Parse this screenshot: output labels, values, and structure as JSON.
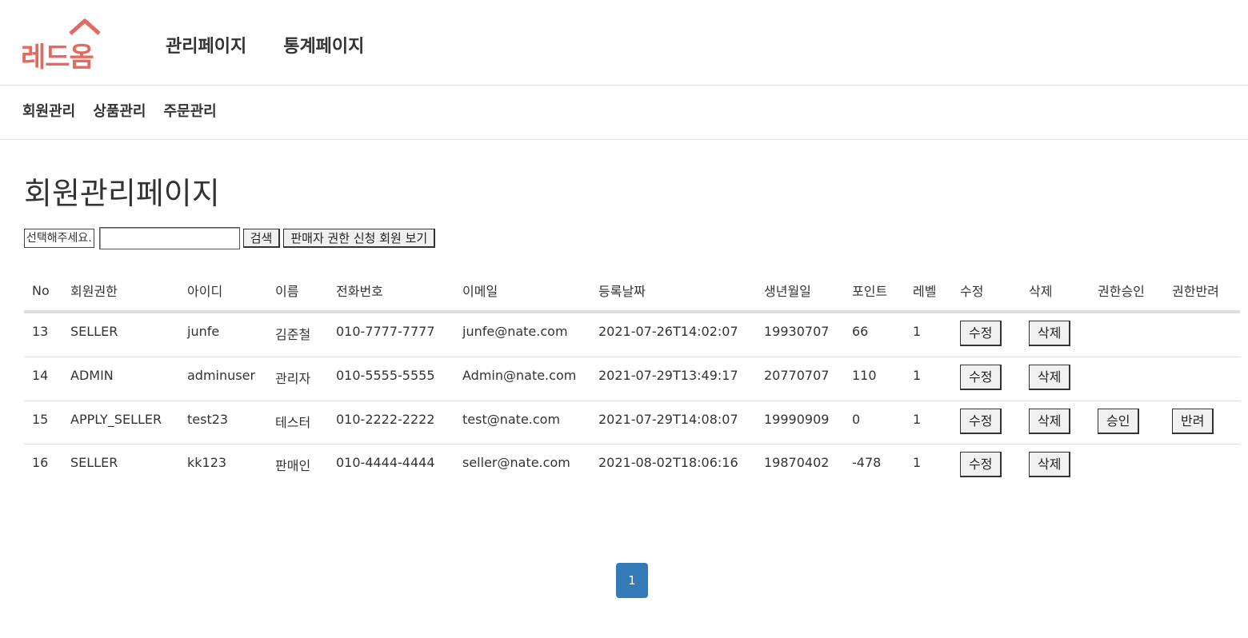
{
  "logo": {
    "text": "레드옴",
    "color": "#e26a5f"
  },
  "topnav": [
    {
      "label": "관리페이지"
    },
    {
      "label": "통계페이지"
    }
  ],
  "subnav": [
    {
      "label": "회원관리"
    },
    {
      "label": "상품관리"
    },
    {
      "label": "주문관리"
    }
  ],
  "page_title": "회원관리페이지",
  "search": {
    "select_label": "선택해주세요.",
    "input_value": "",
    "search_button": "검색",
    "apply_button": "판매자 권한 신청 회원 보기"
  },
  "table": {
    "headers": [
      "No",
      "회원권한",
      "아이디",
      "이름",
      "전화번호",
      "이메일",
      "등록날짜",
      "생년월일",
      "포인트",
      "레벨",
      "수정",
      "삭제",
      "권한승인",
      "권한반려"
    ],
    "rows": [
      {
        "no": "13",
        "role": "SELLER",
        "id": "junfe",
        "name": "김준철",
        "phone": "010-7777-7777",
        "email": "junfe@nate.com",
        "date": "2021-07-26T14:02:07",
        "birth": "19930707",
        "point": "66",
        "level": "1",
        "edit": "수정",
        "delete": "삭제"
      },
      {
        "no": "14",
        "role": "ADMIN",
        "id": "adminuser",
        "name": "관리자",
        "phone": "010-5555-5555",
        "email": "Admin@nate.com",
        "date": "2021-07-29T13:49:17",
        "birth": "20770707",
        "point": "110",
        "level": "1",
        "edit": "수정",
        "delete": "삭제"
      },
      {
        "no": "15",
        "role": "APPLY_SELLER",
        "id": "test23",
        "name": "테스터",
        "phone": "010-2222-2222",
        "email": "test@nate.com",
        "date": "2021-07-29T14:08:07",
        "birth": "19990909",
        "point": "0",
        "level": "1",
        "edit": "수정",
        "delete": "삭제",
        "approve": "승인",
        "reject": "반려"
      },
      {
        "no": "16",
        "role": "SELLER",
        "id": "kk123",
        "name": "판매인",
        "phone": "010-4444-4444",
        "email": "seller@nate.com",
        "date": "2021-08-02T18:06:16",
        "birth": "19870402",
        "point": "-478",
        "level": "1",
        "edit": "수정",
        "delete": "삭제"
      }
    ]
  },
  "pagination": {
    "current": "1",
    "color": "#337ab7"
  }
}
